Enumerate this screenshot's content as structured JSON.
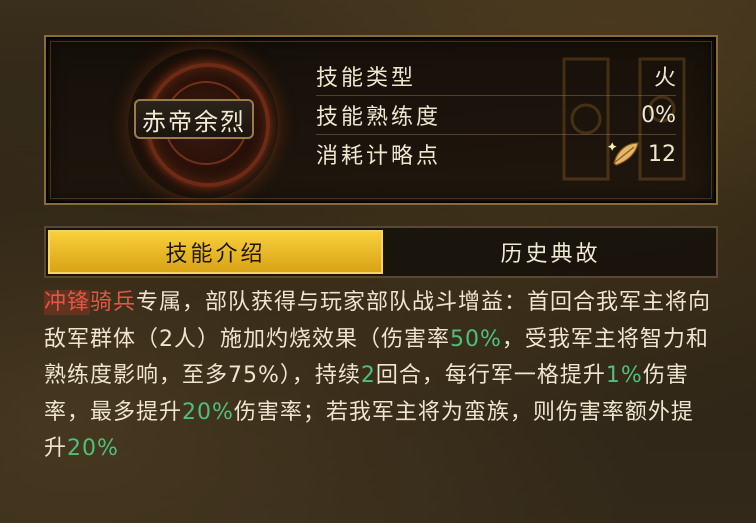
{
  "skill": {
    "name": "赤帝余烈",
    "stats": [
      {
        "label": "技能类型",
        "value": "火"
      },
      {
        "label": "技能熟练度",
        "value": "0%"
      },
      {
        "label": "消耗计略点",
        "value": "12",
        "icon": "feather-icon"
      }
    ]
  },
  "tabs": [
    {
      "label": "技能介绍",
      "active": true
    },
    {
      "label": "历史典故",
      "active": false
    }
  ],
  "description": {
    "segments": [
      {
        "text": "冲锋",
        "style": "tag-charge"
      },
      {
        "text": "骑兵",
        "style": "tag-cav"
      },
      {
        "text": "专属，部队获得与玩家部队战斗增益：首回合我军主将向敌军群体（2人）施加灼烧效果（伤害率",
        "style": ""
      },
      {
        "text": "50%",
        "style": "hl"
      },
      {
        "text": "，受我军主将智力和熟练度影响，至多75%），持续",
        "style": ""
      },
      {
        "text": "2",
        "style": "hl"
      },
      {
        "text": "回合，每行军一格提升",
        "style": ""
      },
      {
        "text": "1%",
        "style": "hl"
      },
      {
        "text": "伤害率，最多提升",
        "style": ""
      },
      {
        "text": "20%",
        "style": "hl"
      },
      {
        "text": "伤害率；若我军主将为蛮族，则伤害率额外提升",
        "style": ""
      },
      {
        "text": "20%",
        "style": "hl"
      }
    ]
  },
  "colors": {
    "accent": "#e9b826",
    "highlight": "#4fc07a",
    "tag": "#e45545"
  }
}
